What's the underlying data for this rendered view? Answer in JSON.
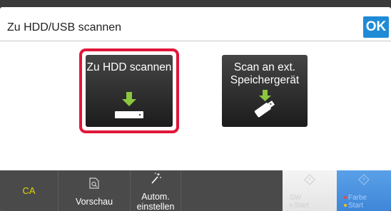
{
  "header": {
    "title": "Zu HDD/USB scannen",
    "ok_label": "OK"
  },
  "tiles": [
    {
      "label": "Zu HDD scannen",
      "icon": "download-to-hdd-icon",
      "selected": true
    },
    {
      "label_line1": "Scan an ext.",
      "label_line2": "Speichergerät",
      "icon": "usb-drive-icon",
      "selected": false
    }
  ],
  "bottom_bar": {
    "ca_label": "CA",
    "preview_label": "Vorschau",
    "auto_label_line1": "Autom.",
    "auto_label_line2": "einstellen",
    "bw_label_line1": "SW",
    "bw_label_line2": "Start",
    "color_label_line1": "Farbe",
    "color_label_line2": "Start"
  },
  "colors": {
    "accent_ok": "#1f8bd6",
    "selection_border": "#e0173a",
    "arrow_green": "#8cc63f",
    "ca_text": "#e6d800",
    "color_start_bg": "#4a90e2"
  }
}
